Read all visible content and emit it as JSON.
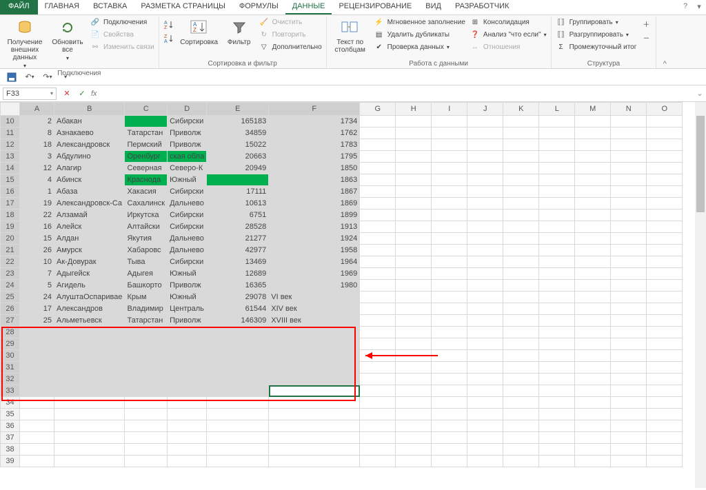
{
  "tabs": {
    "file": "ФАЙЛ",
    "items": [
      "ГЛАВНАЯ",
      "ВСТАВКА",
      "РАЗМЕТКА СТРАНИЦЫ",
      "ФОРМУЛЫ",
      "ДАННЫЕ",
      "РЕЦЕНЗИРОВАНИЕ",
      "ВИД",
      "РАЗРАБОТЧИК"
    ],
    "active_index": 4
  },
  "ribbon": {
    "groups": [
      {
        "name": "connections",
        "label": "Подключения",
        "big": [
          {
            "id": "get-ext",
            "label": "Получение\nвнешних данных",
            "caret": true,
            "icon": "db"
          },
          {
            "id": "refresh",
            "label": "Обновить\nвсе",
            "caret": true,
            "icon": "refresh"
          }
        ],
        "small": [
          {
            "id": "conn",
            "label": "Подключения",
            "icon": "link"
          },
          {
            "id": "props",
            "label": "Свойства",
            "icon": "props",
            "disabled": true
          },
          {
            "id": "editlinks",
            "label": "Изменить связи",
            "icon": "chain",
            "disabled": true
          }
        ]
      },
      {
        "name": "sortfilter",
        "label": "Сортировка и фильтр",
        "big": [
          {
            "id": "sort-az",
            "label": "",
            "icon": "az",
            "narrow": true
          },
          {
            "id": "sort-za",
            "label": "",
            "icon": "za",
            "narrow": true
          },
          {
            "id": "sort",
            "label": "Сортировка",
            "icon": "sort"
          },
          {
            "id": "filter",
            "label": "Фильтр",
            "icon": "filter"
          }
        ],
        "small": [
          {
            "id": "clear",
            "label": "Очистить",
            "icon": "erase",
            "disabled": true
          },
          {
            "id": "reapply",
            "label": "Повторить",
            "icon": "reapply",
            "disabled": true
          },
          {
            "id": "advanced",
            "label": "Дополнительно",
            "icon": "advfilter"
          }
        ]
      },
      {
        "name": "datatools",
        "label": "Работа с данными",
        "big": [
          {
            "id": "ttc",
            "label": "Текст по\nстолбцам",
            "icon": "ttc"
          }
        ],
        "small_cols": [
          [
            {
              "id": "flash",
              "label": "Мгновенное заполнение",
              "icon": "flash"
            },
            {
              "id": "dedup",
              "label": "Удалить дубликаты",
              "icon": "dedup"
            },
            {
              "id": "valid",
              "label": "Проверка данных",
              "icon": "valid",
              "caret": true
            }
          ],
          [
            {
              "id": "consol",
              "label": "Консолидация",
              "icon": "consol"
            },
            {
              "id": "whatif",
              "label": "Анализ \"что если\"",
              "icon": "whatif",
              "caret": true
            },
            {
              "id": "rel",
              "label": "Отношения",
              "icon": "rel",
              "disabled": true
            }
          ]
        ]
      },
      {
        "name": "outline",
        "label": "Структура",
        "small_cols": [
          [
            {
              "id": "group",
              "label": "Группировать",
              "icon": "group",
              "caret": true
            },
            {
              "id": "ungroup",
              "label": "Разгруппировать",
              "icon": "ungroup",
              "caret": true
            },
            {
              "id": "subtotal",
              "label": "Промежуточный итог",
              "icon": "subtotal"
            }
          ]
        ],
        "side": [
          {
            "id": "show-detail",
            "icon": "plus"
          },
          {
            "id": "hide-detail",
            "icon": "minus"
          }
        ]
      }
    ]
  },
  "formula_bar": {
    "namebox": "F33",
    "formula": ""
  },
  "columns": [
    "A",
    "B",
    "C",
    "D",
    "E",
    "F",
    "G",
    "H",
    "I",
    "J",
    "K",
    "L",
    "M",
    "N",
    "O"
  ],
  "selected_cols": [
    "A",
    "B",
    "C",
    "D",
    "E",
    "F"
  ],
  "selected_rows_from": 10,
  "selected_rows_to": 33,
  "active_cell": "F33",
  "rows": [
    {
      "r": 10,
      "A": 2,
      "B": "Абакан",
      "C": "",
      "Cgreen": true,
      "D": "Сибирски",
      "E": 165183,
      "F": 1734,
      "Ftype": "num"
    },
    {
      "r": 11,
      "A": 8,
      "B": "Азнакаево",
      "C": "Татарстан",
      "D": "Приволж",
      "E": 34859,
      "F": 1762,
      "Ftype": "num"
    },
    {
      "r": 12,
      "A": 18,
      "B": "Александровск",
      "C": "Пермский",
      "D": "Приволж",
      "E": 15022,
      "F": 1783,
      "Ftype": "num"
    },
    {
      "r": 13,
      "A": 3,
      "B": "Абдулино",
      "C": "Оренбург",
      "Cgreen": true,
      "D": "ская обла",
      "Dgreen": true,
      "E": 20663,
      "F": 1795,
      "Ftype": "num"
    },
    {
      "r": 14,
      "A": 12,
      "B": "Алагир",
      "C": "Северная",
      "D": "Северо-К",
      "E": 20949,
      "F": 1850,
      "Ftype": "num"
    },
    {
      "r": 15,
      "A": 4,
      "B": "Абинск",
      "C": "Краснода",
      "Cgreen": true,
      "D": "Южный",
      "E": "",
      "Egreen": true,
      "F": 1863,
      "Ftype": "num"
    },
    {
      "r": 16,
      "A": 1,
      "B": "Абаза",
      "C": "Хакасия",
      "D": "Сибирски",
      "E": 17111,
      "F": 1867,
      "Ftype": "num"
    },
    {
      "r": 17,
      "A": 19,
      "B": "Александровск-Са",
      "C": "Сахалинск",
      "D": "Дальнево",
      "E": 10613,
      "F": 1869,
      "Ftype": "num"
    },
    {
      "r": 18,
      "A": 22,
      "B": "Алзамай",
      "C": "Иркутска",
      "D": "Сибирски",
      "E": 6751,
      "F": 1899,
      "Ftype": "num"
    },
    {
      "r": 19,
      "A": 16,
      "B": "Алейск",
      "C": "Алтайски",
      "D": "Сибирски",
      "E": 28528,
      "F": 1913,
      "Ftype": "num"
    },
    {
      "r": 20,
      "A": 15,
      "B": "Алдан",
      "C": "Якутия",
      "D": "Дальнево",
      "E": 21277,
      "F": 1924,
      "Ftype": "num"
    },
    {
      "r": 21,
      "A": 26,
      "B": "Амурск",
      "C": "Хабаровс",
      "D": "Дальнево",
      "E": 42977,
      "F": 1958,
      "Ftype": "num"
    },
    {
      "r": 22,
      "A": 10,
      "B": "Ак-Довурак",
      "C": "Тыва",
      "D": "Сибирски",
      "E": 13469,
      "F": 1964,
      "Ftype": "num"
    },
    {
      "r": 23,
      "A": 7,
      "B": "Адыгейск",
      "C": "Адыгея",
      "D": "Южный",
      "E": 12689,
      "F": 1969,
      "Ftype": "num"
    },
    {
      "r": 24,
      "A": 5,
      "B": "Агидель",
      "C": "Башкорто",
      "D": "Приволж",
      "E": 16365,
      "F": 1980,
      "Ftype": "num"
    },
    {
      "r": 25,
      "A": 24,
      "B": "АлуштаОспаривае",
      "C": "Крым",
      "D": "Южный",
      "E": 29078,
      "F": "VI век",
      "Ftype": "text"
    },
    {
      "r": 26,
      "A": 17,
      "B": "Александров",
      "C": "Владимир",
      "D": "Централь",
      "E": 61544,
      "F": "XIV век",
      "Ftype": "text"
    },
    {
      "r": 27,
      "A": 25,
      "B": "Альметьевск",
      "C": "Татарстан",
      "D": "Приволж",
      "E": 146309,
      "F": "XVIII век",
      "Ftype": "text"
    }
  ],
  "empty_rows": [
    28,
    29,
    30,
    31,
    32,
    33,
    34,
    35,
    36,
    37,
    38,
    39
  ]
}
